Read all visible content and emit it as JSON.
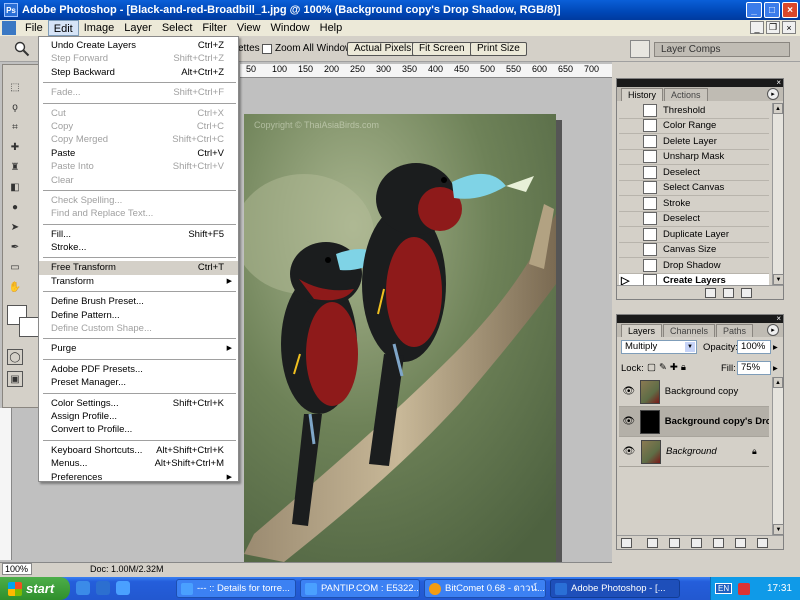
{
  "window": {
    "app_name": "Adobe Photoshop",
    "title": "Adobe Photoshop - [Black-and-red-Broadbill_1.jpg @ 100% (Background copy's Drop Shadow, RGB/8)]"
  },
  "menubar": {
    "items": [
      "File",
      "Edit",
      "Image",
      "Layer",
      "Select",
      "Filter",
      "View",
      "Window",
      "Help"
    ],
    "active": "Edit"
  },
  "options_bar": {
    "zoom_all_windows_label": "Zoom All Windows",
    "partial_label": "ettes",
    "actual_pixels": "Actual Pixels",
    "fit_screen": "Fit Screen",
    "print_size": "Print Size",
    "layer_comps_tab": "Layer Comps"
  },
  "edit_menu": {
    "groups": [
      [
        {
          "label": "Undo Create Layers",
          "shortcut": "Ctrl+Z",
          "enabled": true
        },
        {
          "label": "Step Forward",
          "shortcut": "Shift+Ctrl+Z",
          "enabled": false
        },
        {
          "label": "Step Backward",
          "shortcut": "Alt+Ctrl+Z",
          "enabled": true
        }
      ],
      [
        {
          "label": "Fade...",
          "shortcut": "Shift+Ctrl+F",
          "enabled": false
        }
      ],
      [
        {
          "label": "Cut",
          "shortcut": "Ctrl+X",
          "enabled": false
        },
        {
          "label": "Copy",
          "shortcut": "Ctrl+C",
          "enabled": false
        },
        {
          "label": "Copy Merged",
          "shortcut": "Shift+Ctrl+C",
          "enabled": false
        },
        {
          "label": "Paste",
          "shortcut": "Ctrl+V",
          "enabled": true
        },
        {
          "label": "Paste Into",
          "shortcut": "Shift+Ctrl+V",
          "enabled": false
        },
        {
          "label": "Clear",
          "shortcut": "",
          "enabled": false
        }
      ],
      [
        {
          "label": "Check Spelling...",
          "shortcut": "",
          "enabled": false
        },
        {
          "label": "Find and Replace Text...",
          "shortcut": "",
          "enabled": false
        }
      ],
      [
        {
          "label": "Fill...",
          "shortcut": "Shift+F5",
          "enabled": true
        },
        {
          "label": "Stroke...",
          "shortcut": "",
          "enabled": true
        }
      ],
      [
        {
          "label": "Free Transform",
          "shortcut": "Ctrl+T",
          "enabled": true,
          "highlight": true
        },
        {
          "label": "Transform",
          "shortcut": "",
          "enabled": true,
          "submenu": true
        }
      ],
      [
        {
          "label": "Define Brush Preset...",
          "shortcut": "",
          "enabled": true
        },
        {
          "label": "Define Pattern...",
          "shortcut": "",
          "enabled": true
        },
        {
          "label": "Define Custom Shape...",
          "shortcut": "",
          "enabled": false
        }
      ],
      [
        {
          "label": "Purge",
          "shortcut": "",
          "enabled": true,
          "submenu": true
        }
      ],
      [
        {
          "label": "Adobe PDF Presets...",
          "shortcut": "",
          "enabled": true
        },
        {
          "label": "Preset Manager...",
          "shortcut": "",
          "enabled": true
        }
      ],
      [
        {
          "label": "Color Settings...",
          "shortcut": "Shift+Ctrl+K",
          "enabled": true
        },
        {
          "label": "Assign Profile...",
          "shortcut": "",
          "enabled": true
        },
        {
          "label": "Convert to Profile...",
          "shortcut": "",
          "enabled": true
        }
      ],
      [
        {
          "label": "Keyboard Shortcuts...",
          "shortcut": "Alt+Shift+Ctrl+K",
          "enabled": true
        },
        {
          "label": "Menus...",
          "shortcut": "Alt+Shift+Ctrl+M",
          "enabled": true
        },
        {
          "label": "Preferences",
          "shortcut": "",
          "enabled": true,
          "submenu": true
        }
      ]
    ]
  },
  "ruler": {
    "ticks": [
      "50",
      "100",
      "150",
      "200",
      "250",
      "300",
      "350",
      "400",
      "450",
      "500",
      "550",
      "600",
      "650",
      "700"
    ]
  },
  "document": {
    "zoom": "100%",
    "doc_size": "Doc: 1.00M/2.32M",
    "watermark": "Copyright © ThaiAsiaBirds.com"
  },
  "history_panel": {
    "tabs": [
      "History",
      "Actions"
    ],
    "items": [
      "Threshold",
      "Color Range",
      "Delete Layer",
      "Unsharp Mask",
      "Deselect",
      "Select Canvas",
      "Stroke",
      "Deselect",
      "Duplicate Layer",
      "Canvas Size",
      "Drop Shadow",
      "Create Layers"
    ],
    "active": "Create Layers"
  },
  "layers_panel": {
    "tabs": [
      "Layers",
      "Channels",
      "Paths"
    ],
    "blend_mode": "Multiply",
    "opacity_label": "Opacity:",
    "opacity": "100%",
    "lock_label": "Lock:",
    "fill_label": "Fill:",
    "fill": "75%",
    "layers": [
      {
        "name": "Background copy",
        "selected": false
      },
      {
        "name": "Background copy's Drop ...",
        "selected": true
      },
      {
        "name": "Background",
        "selected": false,
        "locked": true
      }
    ]
  },
  "taskbar": {
    "start_label": "start",
    "buttons": [
      {
        "label": "--- :: Details for torre...",
        "active": false
      },
      {
        "label": "PANTIP.COM : E5322...",
        "active": false
      },
      {
        "label": "BitComet 0.68 - ดาวน์...",
        "active": false
      },
      {
        "label": "Adobe Photoshop - [...",
        "active": true
      }
    ],
    "lang": "EN",
    "clock": "17:31"
  },
  "colors": {
    "title_blue": "#0047b6",
    "taskbar_blue": "#245edb",
    "start_green": "#2f8f2c",
    "bird_red": "#8e1a1a",
    "bird_black": "#1b1d1e",
    "beak_cyan": "#7fd3e6"
  }
}
